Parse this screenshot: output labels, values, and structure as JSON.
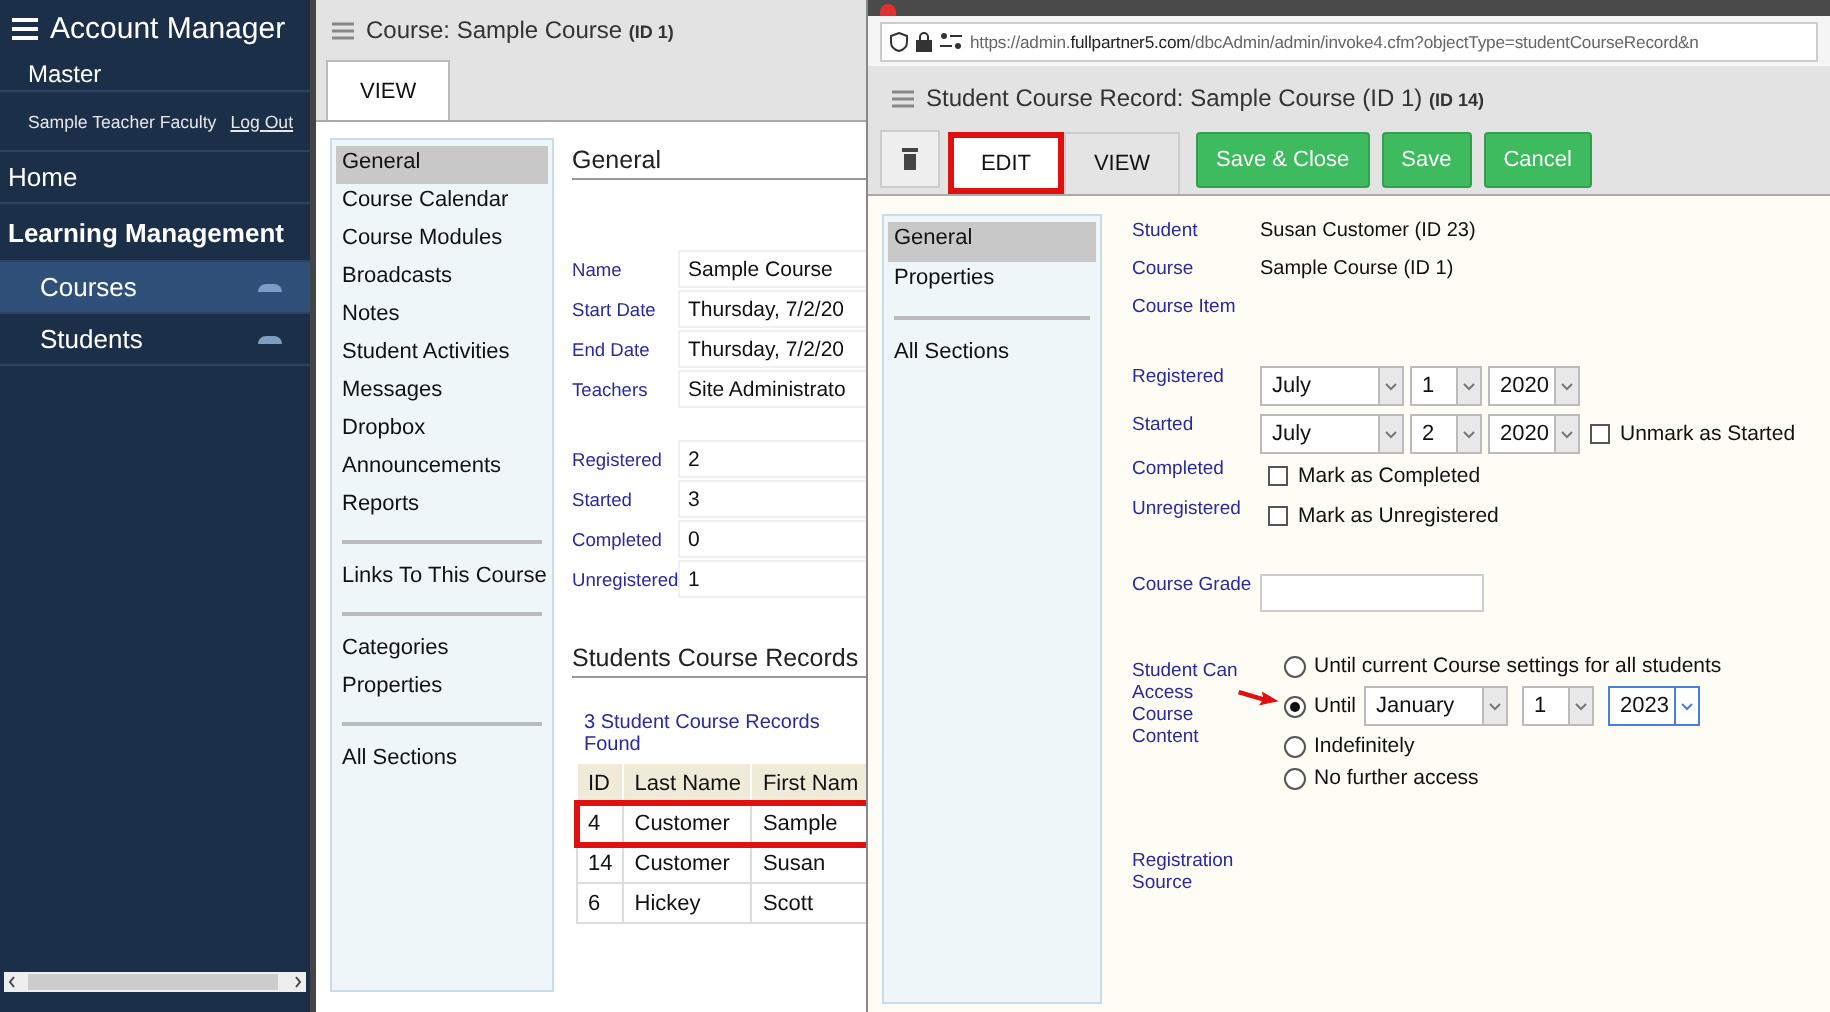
{
  "sidebar": {
    "title": "Account Manager",
    "account": "Master",
    "user": "Sample Teacher Faculty",
    "logout": "Log Out",
    "items": [
      {
        "label": "Home",
        "kind": "link",
        "selected": false
      },
      {
        "label": "Learning Management",
        "kind": "heading",
        "selected": false
      },
      {
        "label": "Courses",
        "kind": "sub",
        "selected": true
      },
      {
        "label": "Students",
        "kind": "sub",
        "selected": false
      }
    ]
  },
  "course_window": {
    "title": "Course: Sample Course",
    "title_id": "(ID 1)",
    "tabs": [
      {
        "label": "VIEW",
        "selected": true
      }
    ],
    "nav": [
      [
        {
          "label": "General",
          "selected": true
        },
        {
          "label": "Course Calendar",
          "selected": false
        },
        {
          "label": "Course Modules",
          "selected": false
        },
        {
          "label": "Broadcasts",
          "selected": false
        },
        {
          "label": "Notes",
          "selected": false
        },
        {
          "label": "Student Activities",
          "selected": false
        },
        {
          "label": "Messages",
          "selected": false
        },
        {
          "label": "Dropbox",
          "selected": false
        },
        {
          "label": "Announcements",
          "selected": false
        },
        {
          "label": "Reports",
          "selected": false
        }
      ],
      [
        {
          "label": "Links To This Course",
          "selected": false
        }
      ],
      [
        {
          "label": "Categories",
          "selected": false
        },
        {
          "label": "Properties",
          "selected": false
        }
      ],
      [
        {
          "label": "All Sections",
          "selected": false
        }
      ]
    ],
    "heading": "General",
    "fields": [
      {
        "label": "Name",
        "value": "Sample Course"
      },
      {
        "label": "Start Date",
        "value": "Thursday, 7/2/20"
      },
      {
        "label": "End Date",
        "value": "Thursday, 7/2/20"
      },
      {
        "label": "Teachers",
        "value": "Site Administrato"
      }
    ],
    "counts": [
      {
        "label": "Registered",
        "value": "2"
      },
      {
        "label": "Started",
        "value": "3"
      },
      {
        "label": "Completed",
        "value": "0"
      },
      {
        "label": "Unregistered",
        "value": "1"
      }
    ],
    "records_heading": "Students Course Records",
    "records_found": "3 Student Course Records Found",
    "table": {
      "columns": [
        "ID",
        "Last Name",
        "First Nam"
      ],
      "rows": [
        {
          "cells": [
            "4",
            "Customer",
            "Sample"
          ],
          "highlighted": true
        },
        {
          "cells": [
            "14",
            "Customer",
            "Susan"
          ],
          "highlighted": false
        },
        {
          "cells": [
            "6",
            "Hickey",
            "Scott"
          ],
          "highlighted": false
        }
      ]
    }
  },
  "record_window": {
    "url": "https://admin.**fullpartner5.com**/dbcAdmin/admin/invoke4.cfm?objectType=studentCourseRecord&n",
    "title": "Student Course Record: Sample Course (ID 1)",
    "title_id": "(ID 14)",
    "tabs": [
      {
        "label": "EDIT",
        "selected": true,
        "highlighted": true
      },
      {
        "label": "VIEW",
        "selected": false,
        "highlighted": false
      }
    ],
    "buttons": [
      "Save & Close",
      "Save",
      "Cancel"
    ],
    "nav": [
      [
        {
          "label": "General",
          "selected": true
        },
        {
          "label": "Properties",
          "selected": false
        }
      ],
      [
        {
          "label": "All Sections",
          "selected": false
        }
      ]
    ],
    "info": [
      {
        "label": "Student",
        "value": "Susan Customer (ID 23)"
      },
      {
        "label": "Course",
        "value": "Sample Course (ID 1)"
      },
      {
        "label": "Course Item"
      }
    ],
    "dates": [
      {
        "label": "Registered",
        "kind": "date",
        "month": "July",
        "day": "1",
        "year": "2020"
      },
      {
        "label": "Started",
        "kind": "date",
        "month": "July",
        "day": "2",
        "year": "2020",
        "checkbox": {
          "label": "Unmark as Started",
          "checked": false
        }
      },
      {
        "label": "Completed",
        "kind": "check",
        "checkbox": {
          "label": "Mark as Completed",
          "checked": false
        }
      },
      {
        "label": "Unregistered",
        "kind": "check",
        "checkbox": {
          "label": "Mark as Unregistered",
          "checked": false
        }
      }
    ],
    "grade_label": "Course Grade",
    "access_label": "Student Can Access Course Content",
    "access_options": [
      {
        "label": "Until current Course settings for all students",
        "kind": "plain",
        "selected": false
      },
      {
        "label": "Until",
        "kind": "date",
        "selected": true,
        "pointed": true,
        "month": "January",
        "day": "1",
        "year": "2023",
        "year_focused": true
      },
      {
        "label": "Indefinitely",
        "kind": "plain",
        "selected": false
      },
      {
        "label": "No further access",
        "kind": "plain",
        "selected": false
      }
    ],
    "source_label": "Registration Source"
  }
}
